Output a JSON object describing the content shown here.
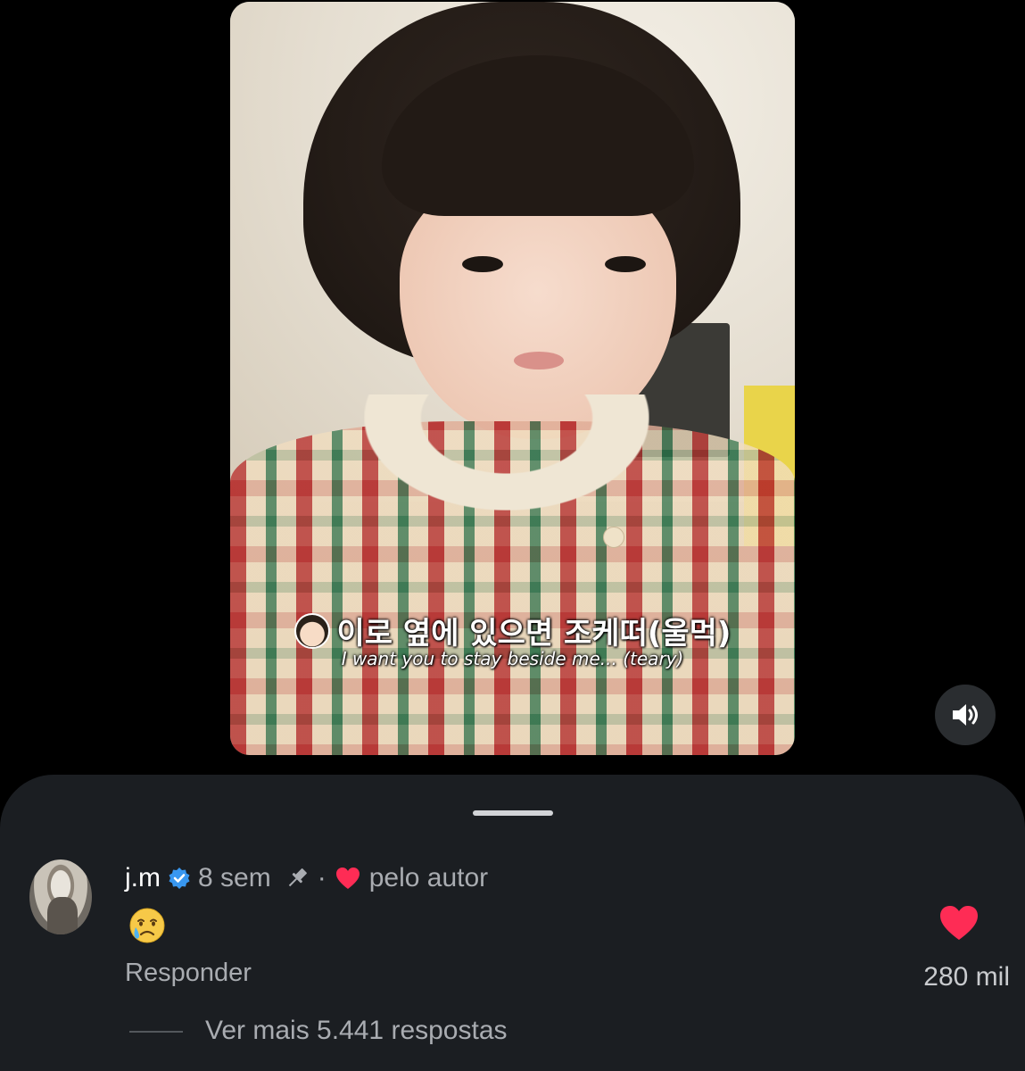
{
  "video": {
    "caption_ko": "이로 옆에 있으면 조케떠(울먹)",
    "caption_en": "I want you to stay beside me... (teary)",
    "sound_icon": "speaker-on-icon"
  },
  "comment": {
    "username": "j.m",
    "verified_icon": "verified-badge-icon",
    "time": "8 sem",
    "pin_icon": "pin-icon",
    "separator": "·",
    "liked_by_author_icon": "heart-icon",
    "liked_by_author_label": "pelo autor",
    "body_emoji": "crying-face-emoji",
    "reply_label": "Responder",
    "like_icon": "heart-filled-icon",
    "like_count": "280 mil",
    "view_more_label": "Ver mais 5.441 respostas"
  },
  "colors": {
    "background": "#000000",
    "sheet": "#1b1e22",
    "heart": "#fe2c55",
    "verified": "#3897f0",
    "muted_text": "#a9acb1"
  }
}
